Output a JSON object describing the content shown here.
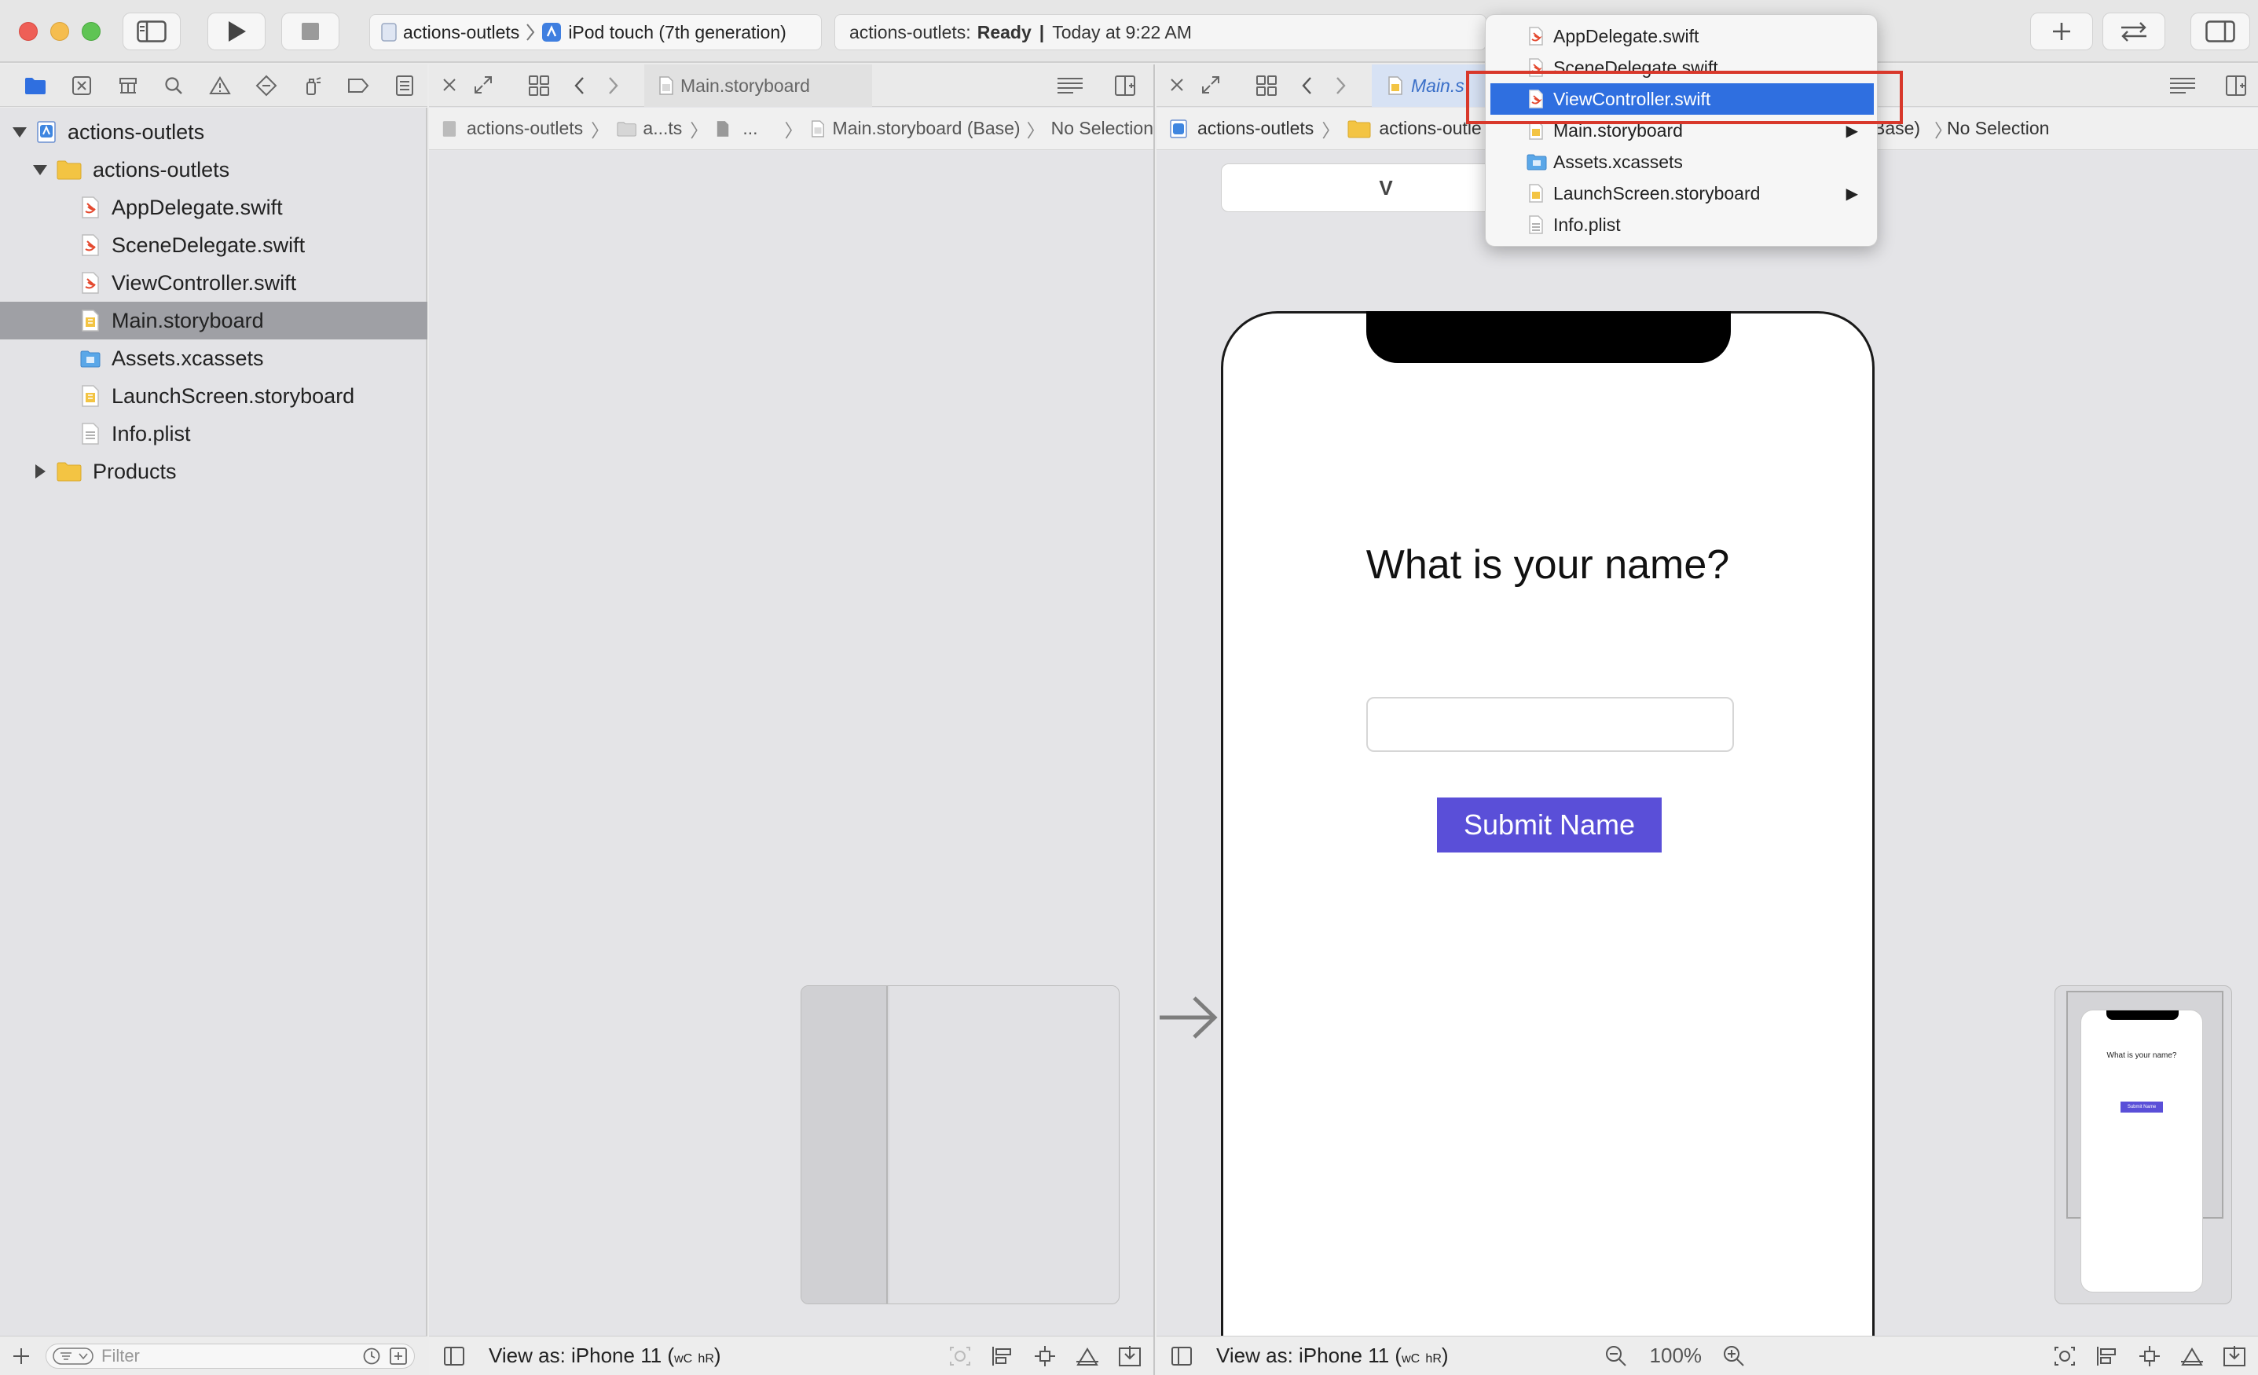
{
  "toolbar": {
    "scheme_project": "actions-outlets",
    "scheme_device": "iPod touch (7th generation)",
    "status_project": "actions-outlets:",
    "status_state": "Ready",
    "status_time": "Today at 9:22 AM"
  },
  "navigator": {
    "items": [
      {
        "label": "actions-outlets",
        "kind": "project"
      },
      {
        "label": "actions-outlets",
        "kind": "folder"
      },
      {
        "label": "AppDelegate.swift",
        "kind": "swift"
      },
      {
        "label": "SceneDelegate.swift",
        "kind": "swift"
      },
      {
        "label": "ViewController.swift",
        "kind": "swift"
      },
      {
        "label": "Main.storyboard",
        "kind": "storyboard",
        "selected": true
      },
      {
        "label": "Assets.xcassets",
        "kind": "assets"
      },
      {
        "label": "LaunchScreen.storyboard",
        "kind": "storyboard"
      },
      {
        "label": "Info.plist",
        "kind": "plist"
      },
      {
        "label": "Products",
        "kind": "folder"
      }
    ],
    "filter_placeholder": "Filter"
  },
  "left_editor": {
    "tab": "Main.storyboard",
    "crumbs": [
      "actions-outlets",
      "a...ts",
      "...",
      "Main.storyboard (Base)",
      "No Selection"
    ],
    "view_as": "View as: iPhone 11",
    "size_w": "wC",
    "size_h": "hR"
  },
  "right_editor": {
    "tab": "Main.s",
    "crumbs": [
      "actions-outlets",
      "actions-outle",
      "Base)",
      "No Selection"
    ],
    "view_as": "View as: iPhone 11",
    "size_w": "wC",
    "size_h": "hR",
    "zoom": "100%",
    "scene_header": "V"
  },
  "phone": {
    "question": "What is your name?",
    "button": "Submit Name",
    "mini_question": "What is your name?",
    "mini_button": "Submit Name"
  },
  "menu": {
    "items": [
      {
        "label": "AppDelegate.swift",
        "kind": "swift"
      },
      {
        "label": "SceneDelegate.swift",
        "kind": "swift"
      },
      {
        "label": "ViewController.swift",
        "kind": "swift",
        "highlighted": true
      },
      {
        "label": "Main.storyboard",
        "kind": "storyboard",
        "submenu": true
      },
      {
        "label": "Assets.xcassets",
        "kind": "assets"
      },
      {
        "label": "LaunchScreen.storyboard",
        "kind": "storyboard",
        "submenu": true
      },
      {
        "label": "Info.plist",
        "kind": "plist"
      }
    ]
  },
  "colors": {
    "accent": "#2f6fe0",
    "button": "#5a4fd8",
    "swift": "#e4492f",
    "folder": "#f3c443",
    "highlight_box": "#d8382b"
  }
}
